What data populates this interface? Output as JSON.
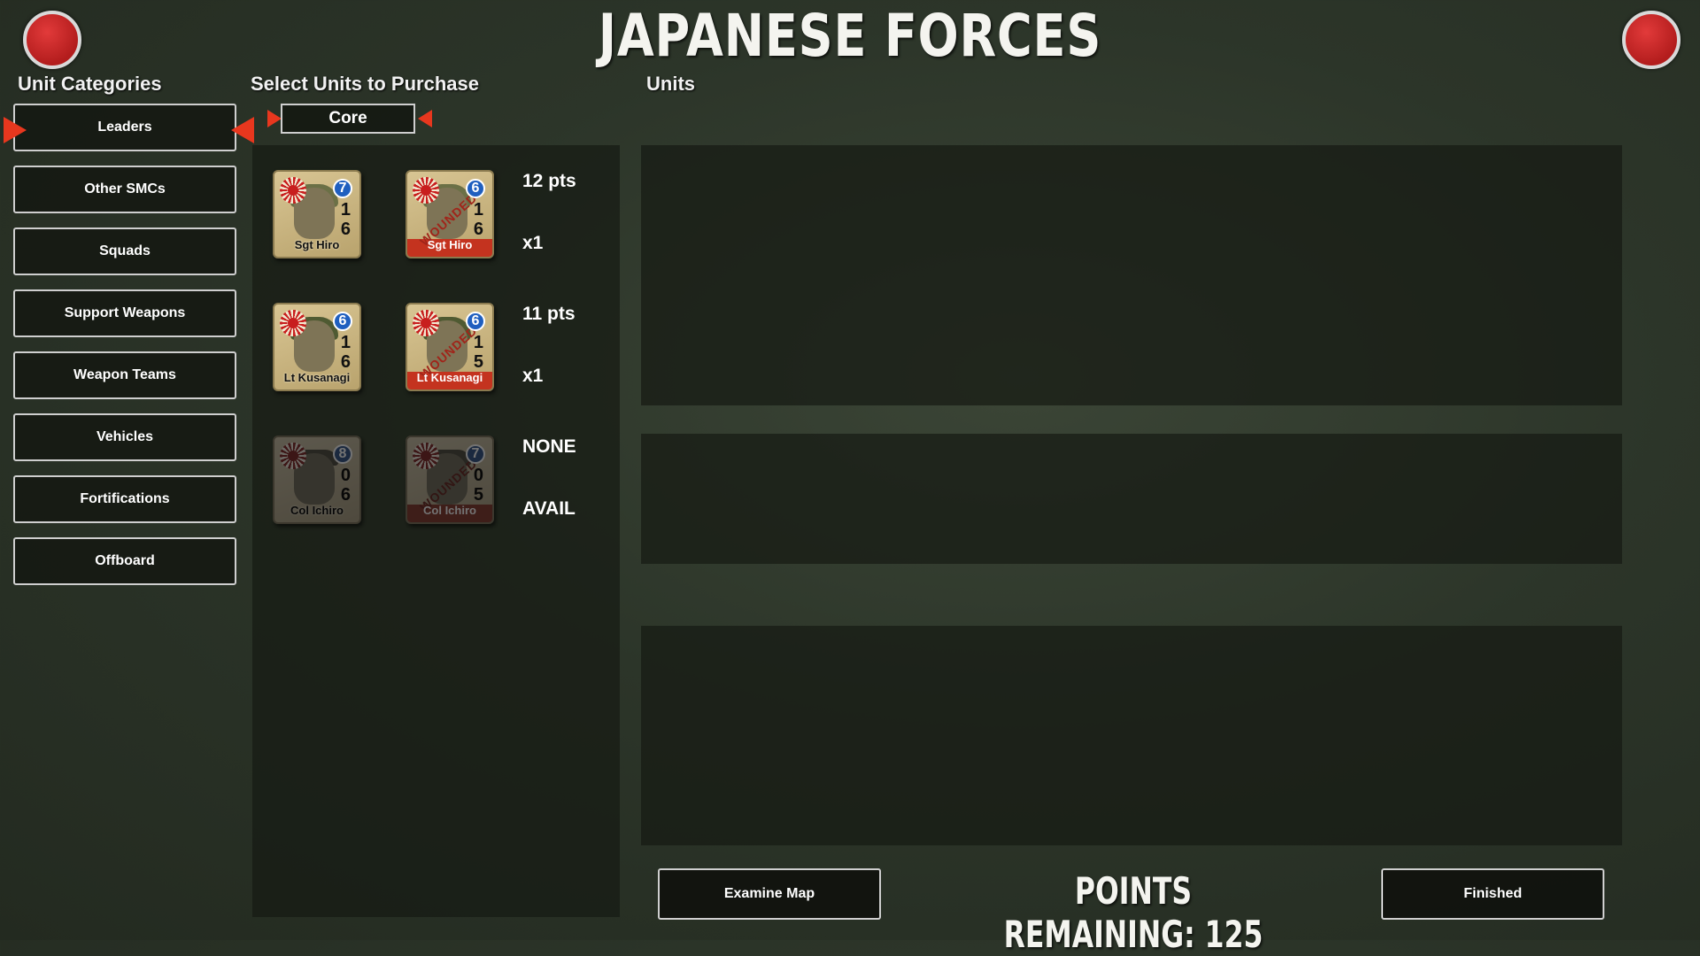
{
  "header": {
    "title": "JAPANESE FORCES"
  },
  "categories": {
    "label": "Unit Categories",
    "items": [
      "Leaders",
      "Other SMCs",
      "Squads",
      "Support Weapons",
      "Weapon Teams",
      "Vehicles",
      "Fortifications",
      "Offboard"
    ],
    "selected": "Leaders"
  },
  "purchase": {
    "label": "Select Units to Purchase",
    "filter": "Core",
    "rows": [
      {
        "name": "Sgt Hiro",
        "normal": {
          "top": "7",
          "mid": "1",
          "bot": "6"
        },
        "wounded": {
          "top": "6",
          "mid": "1",
          "bot": "6"
        },
        "cost": "12 pts",
        "count": "x1",
        "available": true
      },
      {
        "name": "Lt Kusanagi",
        "normal": {
          "top": "6",
          "mid": "1",
          "bot": "6"
        },
        "wounded": {
          "top": "6",
          "mid": "1",
          "bot": "5"
        },
        "cost": "11 pts",
        "count": "x1",
        "available": true
      },
      {
        "name": "Col Ichiro",
        "normal": {
          "top": "8",
          "mid": "0",
          "bot": "6"
        },
        "wounded": {
          "top": "7",
          "mid": "0",
          "bot": "5"
        },
        "cost": "NONE",
        "count": "AVAIL",
        "available": false
      }
    ],
    "wounded_label": "WOUNDED"
  },
  "units": {
    "label": "Units"
  },
  "footer": {
    "examine_label": "Examine Map",
    "points_text": "POINTS REMAINING: 125",
    "finished_label": "Finished"
  },
  "colors": {
    "accent_red": "#e8371e",
    "marker_blue": "#1f5fbf"
  }
}
